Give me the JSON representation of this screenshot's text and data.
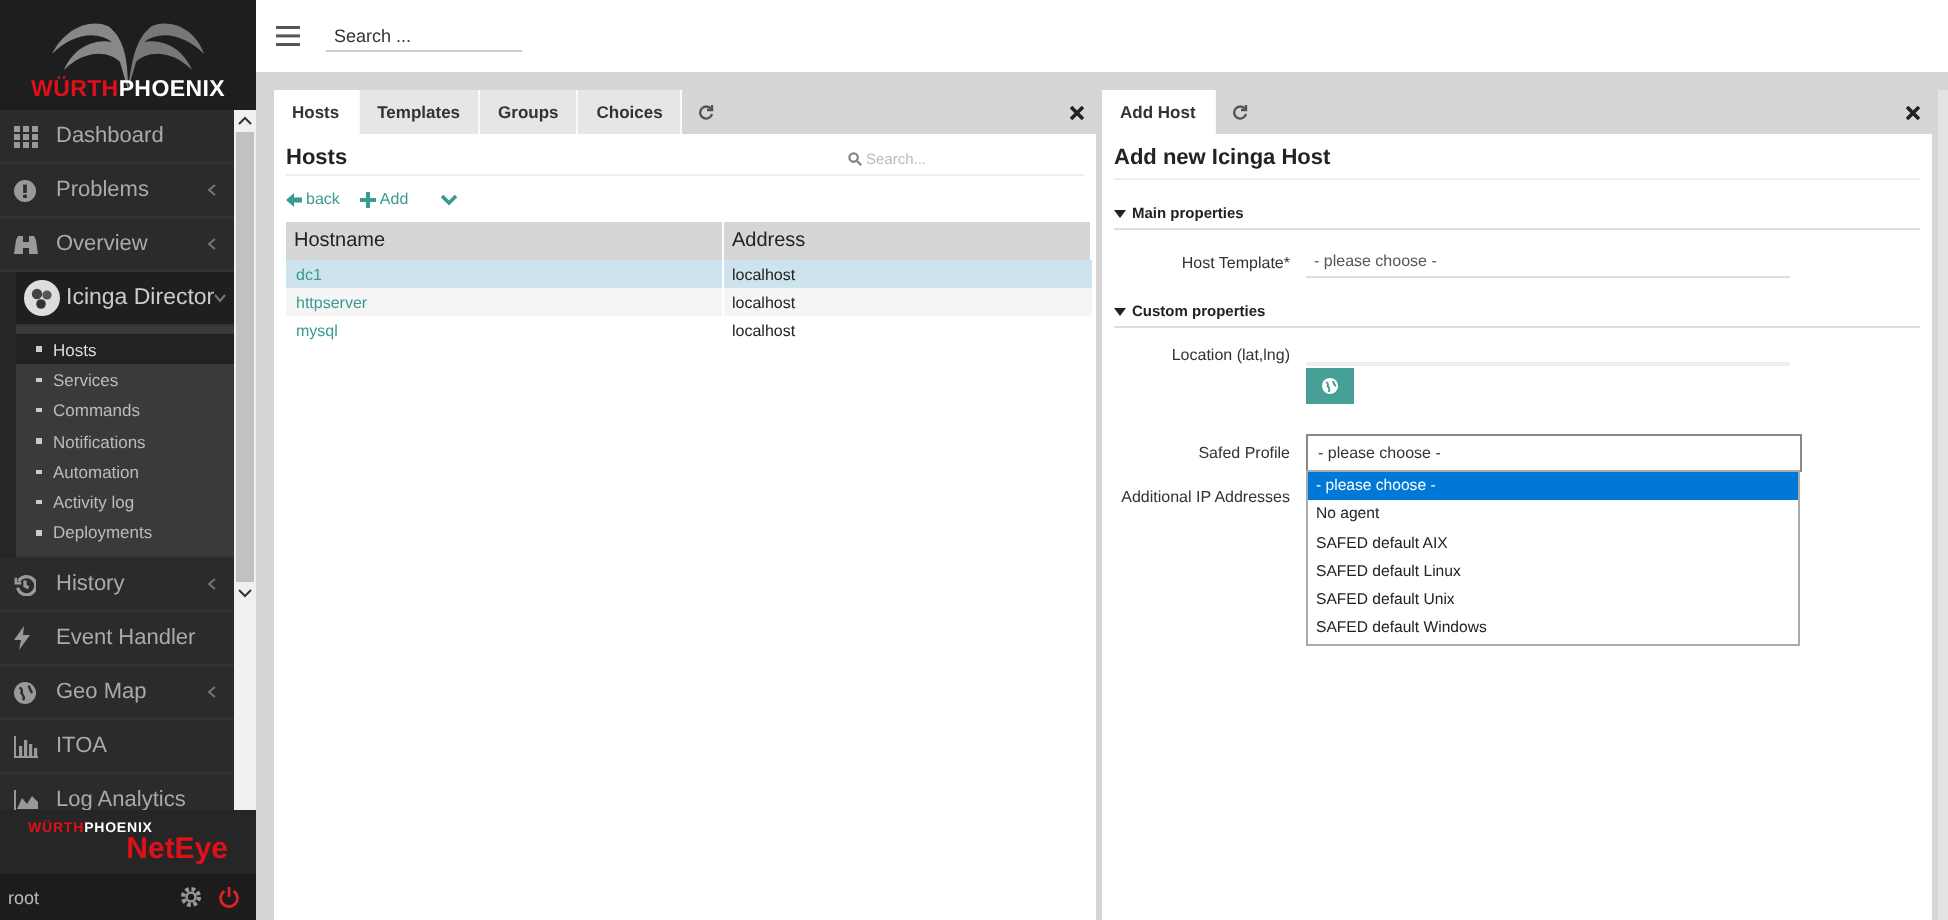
{
  "sidebar": {
    "logo": {
      "red": "WÜRTH",
      "white": "PHOENIX"
    },
    "items": [
      {
        "label": "Dashboard"
      },
      {
        "label": "Problems",
        "expanded": false
      },
      {
        "label": "Overview",
        "expanded": false
      },
      {
        "label": "Icinga Director",
        "expanded": true,
        "children": [
          {
            "label": "Hosts",
            "selected": true
          },
          {
            "label": "Services",
            "selected": false
          },
          {
            "label": "Commands",
            "selected": false
          },
          {
            "label": "Notifications",
            "selected": false
          },
          {
            "label": "Automation",
            "selected": false
          },
          {
            "label": "Activity log",
            "selected": false
          },
          {
            "label": "Deployments",
            "selected": false
          }
        ]
      },
      {
        "label": "History",
        "expanded": false
      },
      {
        "label": "Event Handler"
      },
      {
        "label": "Geo Map",
        "expanded": false
      },
      {
        "label": "ITOA"
      },
      {
        "label": "Log Analytics"
      }
    ],
    "footer_logo": {
      "top_red": "WÜRTH",
      "top_white": "PHOENIX",
      "product": "NetEye"
    },
    "user": "root"
  },
  "topbar": {
    "search": {
      "placeholder": "Search ..."
    }
  },
  "left_panel": {
    "tabs": [
      {
        "label": "Hosts",
        "selected": true
      },
      {
        "label": "Templates",
        "selected": false
      },
      {
        "label": "Groups",
        "selected": false
      },
      {
        "label": "Choices",
        "selected": false
      }
    ],
    "title": "Hosts",
    "search": {
      "placeholder": "Search..."
    },
    "actions": [
      {
        "label": "back",
        "kind": "back"
      },
      {
        "label": "Add",
        "kind": "add"
      }
    ],
    "table": {
      "columns": [
        "Hostname",
        "Address"
      ],
      "rows": [
        {
          "cells": [
            "dc1",
            "localhost"
          ],
          "selected": true
        },
        {
          "cells": [
            "httpserver",
            "localhost"
          ],
          "selected": false
        },
        {
          "cells": [
            "mysql",
            "localhost"
          ],
          "selected": false
        }
      ]
    }
  },
  "right_panel": {
    "tabs": [
      {
        "label": "Add Host",
        "selected": true
      }
    ],
    "title": "Add new Icinga Host",
    "sections": [
      {
        "title": "Main properties",
        "expanded": true,
        "fields": [
          {
            "kind": "select",
            "label": "Host Template*",
            "value": "- please choose -"
          }
        ]
      },
      {
        "title": "Custom properties",
        "expanded": true,
        "fields": [
          {
            "kind": "location",
            "label": "Location (lat,lng)"
          },
          {
            "kind": "dropdown",
            "label": "Safed Profile",
            "value": "- please choose -",
            "options": [
              {
                "label": "- please choose -",
                "selected": true
              },
              {
                "label": "No agent",
                "selected": false
              },
              {
                "label": "SAFED default AIX",
                "selected": false
              },
              {
                "label": "SAFED default Linux",
                "selected": false
              },
              {
                "label": "SAFED default Unix",
                "selected": false
              },
              {
                "label": "SAFED default Windows",
                "selected": false
              }
            ]
          },
          {
            "kind": "label",
            "label": "Additional IP Addresses"
          }
        ]
      }
    ]
  }
}
